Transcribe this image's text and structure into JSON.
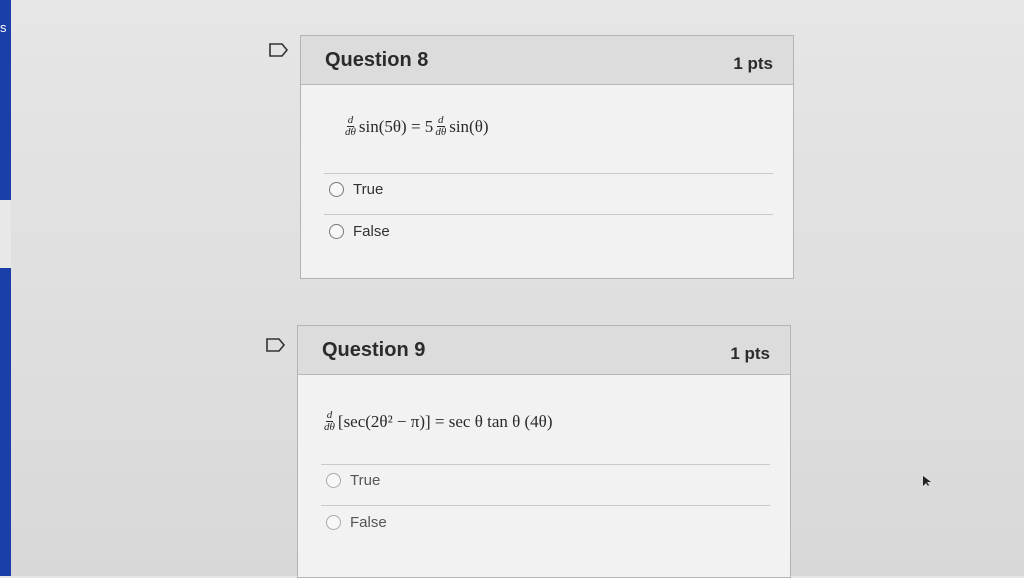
{
  "side_letter": "s",
  "questions": [
    {
      "title": "Question 8",
      "points": "1 pts",
      "equation": {
        "lhs_frac_num": "d",
        "lhs_frac_den": "dθ",
        "lhs_expr": "sin(5θ) = 5",
        "rhs_frac_num": "d",
        "rhs_frac_den": "dθ",
        "rhs_expr": "sin(θ)"
      },
      "answers": [
        "True",
        "False"
      ]
    },
    {
      "title": "Question 9",
      "points": "1 pts",
      "equation": {
        "frac_num": "d",
        "frac_den": "dθ",
        "expr": "[sec(2θ² − π)]  =  sec θ tan θ (4θ)"
      },
      "answers": [
        "True",
        "False"
      ]
    }
  ],
  "icons": {
    "flag": "flag-icon",
    "cursor": "mouse-pointer-icon"
  },
  "colors": {
    "left_strip": "#1a3fa8",
    "card_header": "#dcdcdc",
    "card_body": "#f2f2f2"
  }
}
